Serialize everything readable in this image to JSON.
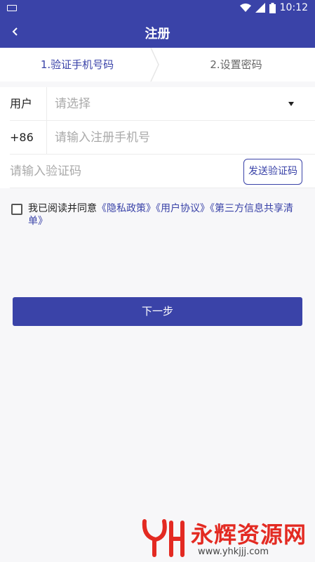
{
  "status_bar": {
    "time": "10:12",
    "icons": [
      "keyboard-icon",
      "wifi-icon",
      "signal-icon",
      "battery-icon"
    ]
  },
  "header": {
    "title": "注册",
    "back_icon": "chevron-left-icon"
  },
  "steps": [
    {
      "label": "1.验证手机号码",
      "active": true
    },
    {
      "label": "2.设置密码",
      "active": false
    }
  ],
  "form": {
    "user_label": "用户",
    "user_placeholder": "请选择",
    "phone_prefix": "+86",
    "phone_placeholder": "请输入注册手机号",
    "code_placeholder": "请输入验证码",
    "send_code_label": "发送验证码"
  },
  "agreement": {
    "prefix": "我已阅读并同意",
    "privacy": "《隐私政策》",
    "user_agreement": "《用户协议》",
    "third_party": "《第三方信息共享清单》",
    "checked": false
  },
  "next_button": "下一步",
  "watermark": {
    "text": "永辉资源网",
    "url": "www.yhkjjj.com"
  },
  "colors": {
    "primary": "#3a43a8",
    "watermark_red": "#e32a22"
  }
}
